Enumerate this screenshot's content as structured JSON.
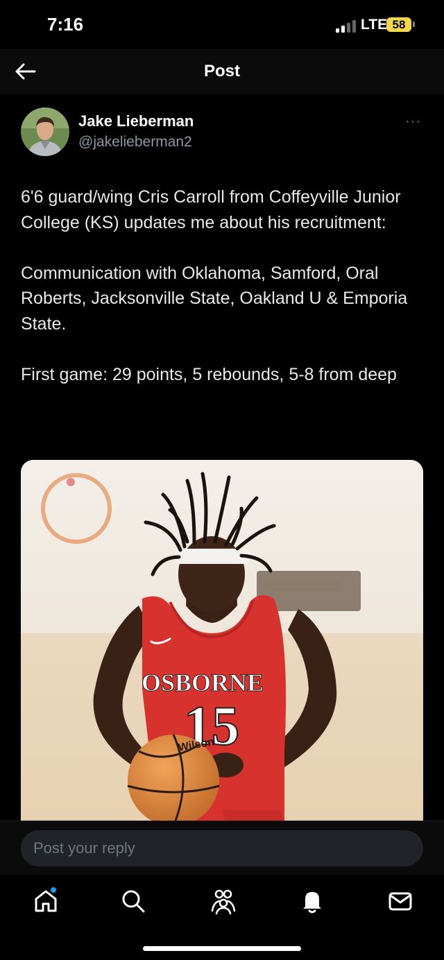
{
  "status_bar": {
    "time": "7:16",
    "network": "LTE",
    "battery": "58",
    "battery_color": "#f5d84a"
  },
  "header": {
    "back_icon": "arrow-left-icon",
    "title": "Post"
  },
  "post": {
    "author": {
      "name": "Jake Lieberman",
      "handle": "@jakelieberman2"
    },
    "more_label": "···",
    "paragraphs": [
      "6'6 guard/wing Cris Carroll from Coffeyville Junior College (KS) updates me about his recruitment:",
      "Communication with Oklahoma, Samford, Oral Roberts, Jacksonville State, Oakland U & Emporia State.",
      "First game: 29 points, 5 rebounds, 5-8 from deep"
    ],
    "media": {
      "jersey_text": "OSBORNE",
      "jersey_number": "15",
      "ball_text": "Wilson",
      "jersey_color": "#d8322e"
    }
  },
  "reply": {
    "placeholder": "Post your reply"
  },
  "tabbar": {
    "items": [
      "home-icon",
      "search-icon",
      "communities-icon",
      "notifications-icon",
      "messages-icon"
    ],
    "active": "home-icon",
    "accent": "#1d9bf0"
  }
}
